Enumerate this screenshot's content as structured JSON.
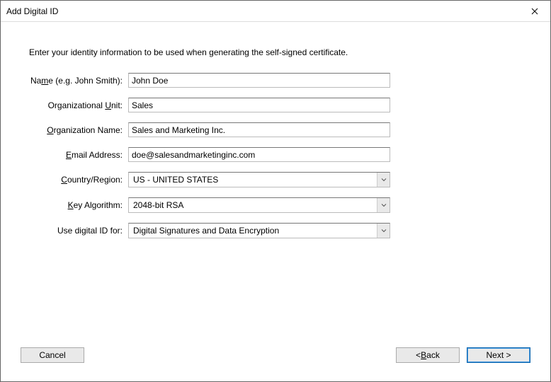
{
  "window": {
    "title": "Add Digital ID"
  },
  "instruction": "Enter your identity information to be used when generating the self-signed certificate.",
  "labels": {
    "name_pre": "Na",
    "name_u": "m",
    "name_post": "e (e.g. John Smith):",
    "org_unit_pre": "Organizational ",
    "org_unit_u": "U",
    "org_unit_post": "nit:",
    "org_name_pre": "",
    "org_name_u": "O",
    "org_name_post": "rganization Name:",
    "email_pre": "",
    "email_u": "E",
    "email_post": "mail Address:",
    "country_pre": "",
    "country_u": "C",
    "country_post": "ountry/Region:",
    "key_pre": "",
    "key_u": "K",
    "key_post": "ey Algorithm:",
    "use_text": "Use digital ID for:"
  },
  "fields": {
    "name": "John Doe",
    "org_unit": "Sales",
    "org_name": "Sales and Marketing Inc.",
    "email": "doe@salesandmarketinginc.com",
    "country": "US - UNITED STATES",
    "key_algorithm": "2048-bit RSA",
    "use_for": "Digital Signatures and Data Encryption"
  },
  "buttons": {
    "cancel": "Cancel",
    "back_pre": "< ",
    "back_u": "B",
    "back_post": "ack",
    "next": "Next >"
  }
}
